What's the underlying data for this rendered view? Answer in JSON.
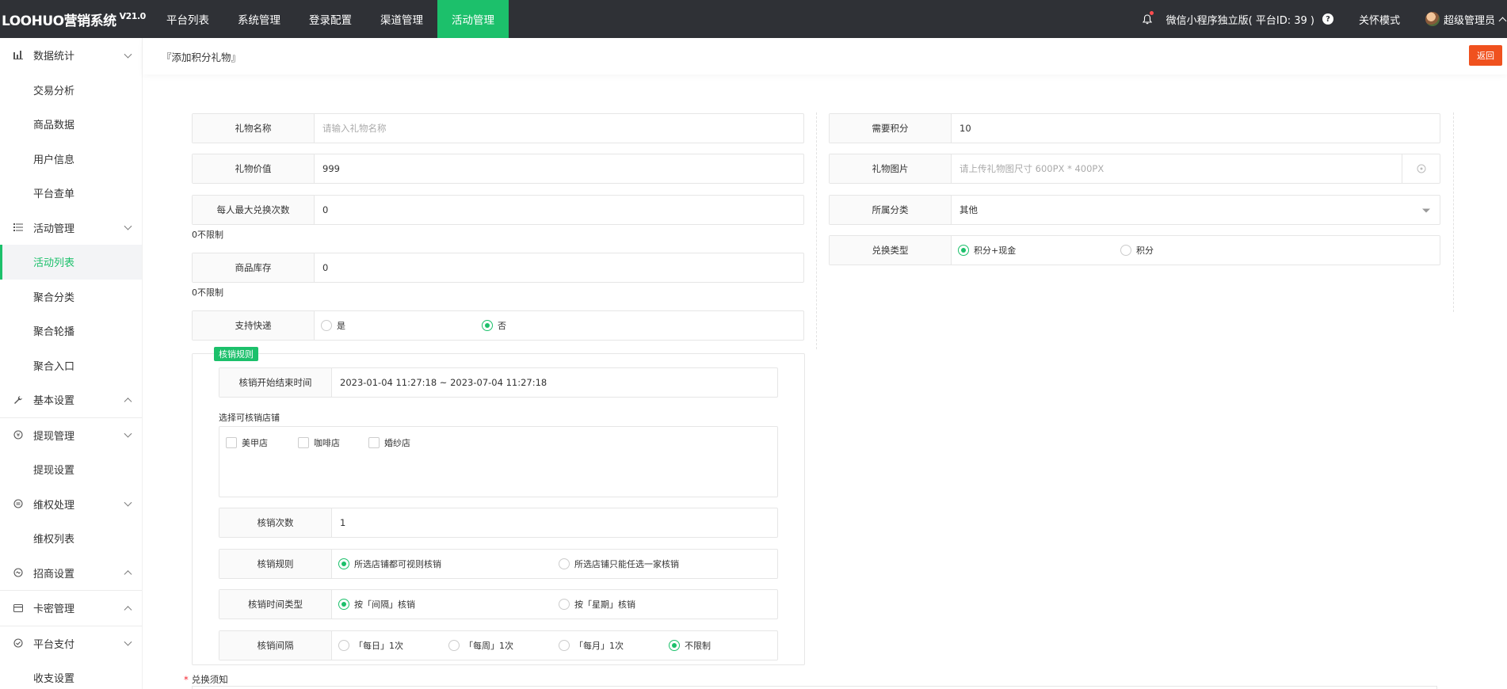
{
  "app": {
    "brand": "LOOHUO营销系统",
    "version": "V21.0"
  },
  "nav": {
    "items": [
      "平台列表",
      "系统管理",
      "登录配置",
      "渠道管理",
      "活动管理"
    ],
    "active_index": 4
  },
  "topright": {
    "platform": "微信小程序独立版( 平台ID: 39 )",
    "care_mode": "关怀模式",
    "user": "超级管理员"
  },
  "sidebar": {
    "groups": [
      {
        "label": "数据统计",
        "icon": "bar-chart-icon",
        "expanded": true,
        "items": [
          "交易分析",
          "商品数据",
          "用户信息",
          "平台查单"
        ]
      },
      {
        "label": "活动管理",
        "icon": "list-icon",
        "expanded": true,
        "items": [
          "活动列表",
          "聚合分类",
          "聚合轮播",
          "聚合入口"
        ]
      },
      {
        "label": "基本设置",
        "icon": "wrench-icon",
        "expanded": false,
        "items": []
      },
      {
        "label": "提现管理",
        "icon": "coin-icon",
        "expanded": true,
        "items": [
          "提现设置"
        ]
      },
      {
        "label": "维权处理",
        "icon": "shield-icon",
        "expanded": true,
        "items": [
          "维权列表"
        ]
      },
      {
        "label": "招商设置",
        "icon": "handshake-icon",
        "expanded": false,
        "items": []
      },
      {
        "label": "卡密管理",
        "icon": "card-icon",
        "expanded": false,
        "items": []
      },
      {
        "label": "平台支付",
        "icon": "check-shield-icon",
        "expanded": true,
        "items": [
          "收支设置"
        ]
      }
    ],
    "active_item": "活动列表"
  },
  "page": {
    "breadcrumb": "『添加积分礼物』",
    "back_label": "返回"
  },
  "form": {
    "gift_name": {
      "label": "礼物名称",
      "placeholder": "请输入礼物名称"
    },
    "gift_value": {
      "label": "礼物价值",
      "value": "999"
    },
    "max_redeem": {
      "label": "每人最大兑换次数",
      "value": "0",
      "hint": "0不限制"
    },
    "stock": {
      "label": "商品库存",
      "value": "0",
      "hint": "0不限制"
    },
    "express": {
      "label": "支持快递",
      "options": [
        "是",
        "否"
      ],
      "selected": 1
    },
    "points_needed": {
      "label": "需要积分",
      "value": "10"
    },
    "gift_image": {
      "label": "礼物图片",
      "placeholder": "请上传礼物图尺寸 600PX * 400PX"
    },
    "category": {
      "label": "所属分类",
      "value": "其他"
    },
    "exchange_type": {
      "label": "兑换类型",
      "options": [
        "积分+现金",
        "积分"
      ],
      "selected": 0
    }
  },
  "rules": {
    "tag": "核销规则",
    "period": {
      "label": "核销开始结束时间",
      "value": "2023-01-04 11:27:18 ~ 2023-07-04 11:27:18"
    },
    "stores_label": "选择可核销店铺",
    "stores": [
      "美甲店",
      "咖啡店",
      "婚纱店"
    ],
    "count": {
      "label": "核销次数",
      "value": "1"
    },
    "rule": {
      "label": "核销规则",
      "options": [
        "所选店铺都可视则核销",
        "所选店铺只能任选一家核销"
      ],
      "selected": 0
    },
    "time_type": {
      "label": "核销时间类型",
      "options": [
        "按「间隔」核销",
        "按「星期」核销"
      ],
      "selected": 0
    },
    "interval": {
      "label": "核销间隔",
      "options": [
        "「每日」1次",
        "「每周」1次",
        "「每月」1次",
        "不限制"
      ],
      "selected": 3
    }
  },
  "notice": {
    "label": "兑换须知"
  }
}
